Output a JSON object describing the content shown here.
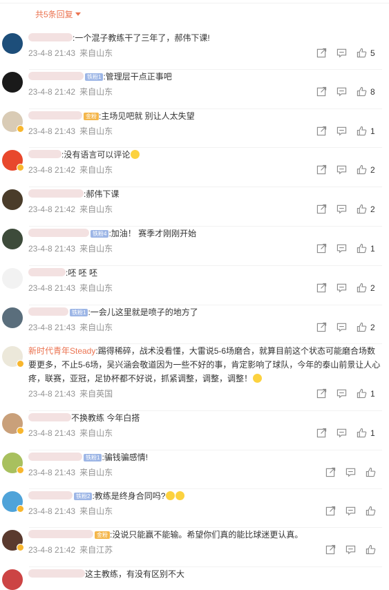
{
  "header": {
    "reply_toggle": "共5条回复"
  },
  "comments": [
    {
      "text": ":一个混子教练干了三年了，郝伟下课!",
      "date": "23-4-8 21:43",
      "location": "来自山东",
      "likes": "5",
      "avatar_color": "#1d4e7a"
    },
    {
      "text": ":管理层干点正事吧",
      "date": "23-4-8 21:42",
      "location": "来自山东",
      "likes": "8",
      "avatar_color": "#1a1a1a",
      "rank": "铁粉1"
    },
    {
      "text": ":主场见吧就  别让人太失望",
      "date": "23-4-8 21:43",
      "location": "来自山东",
      "likes": "1",
      "avatar_color": "#d9cbb5",
      "rank": "金粉"
    },
    {
      "text": ":没有语言可以评论",
      "date": "23-4-8 21:42",
      "location": "来自山东",
      "likes": "2",
      "avatar_color": "#e8482c"
    },
    {
      "text": ":郝伟下课",
      "date": "23-4-8 21:42",
      "location": "来自山东",
      "likes": "2",
      "avatar_color": "#4a3c2a"
    },
    {
      "text": ":加油！ 赛季才刚刚开始",
      "date": "23-4-8 21:43",
      "location": "来自山东",
      "likes": "1",
      "avatar_color": "#3d4b3a",
      "rank": "铁粉4"
    },
    {
      "text": ":呸 呸 呸",
      "date": "23-4-8 21:43",
      "location": "来自山东",
      "likes": "2",
      "avatar_color": "#f2f2f2"
    },
    {
      "text": ":一会儿这里就是喷子的地方了",
      "date": "23-4-8 21:43",
      "location": "来自山东",
      "likes": "2",
      "avatar_color": "#5a6e7c",
      "rank": "铁粉1"
    },
    {
      "name": "新时代青年Steady",
      "text": ":踢得稀碎，战术没看懂，大雷说5-6场磨合，就算目前这个状态可能磨合场数要更多，不止5-6场，吴兴涵会敬道因为一些不好的事，肯定影响了球队，今年的泰山前景让人心疼，联赛，亚冠，足协杯都不好说，抓紧调整，调整，调整！",
      "date": "23-4-8 21:43",
      "location": "来自英国",
      "likes": "1",
      "avatar_color": "#ece8da"
    },
    {
      "text": "不换教练 今年白搭",
      "date": "23-4-8 21:43",
      "location": "来自山东",
      "likes": "1",
      "avatar_color": "#c9a07a"
    },
    {
      "text": ":骗钱骗感情!",
      "date": "23-4-8 21:43",
      "location": "来自山东",
      "likes": "",
      "avatar_color": "#a8c05e",
      "rank": "铁粉1"
    },
    {
      "text": ":教练是终身合同吗?",
      "date": "23-4-8 21:43",
      "location": "来自山东",
      "likes": "",
      "avatar_color": "#4fa3d9",
      "rank": "铁粉2"
    },
    {
      "text": ":没说只能赢不能输。希望你们真的能比球迷更认真。",
      "date": "23-4-8 21:42",
      "location": "来自江苏",
      "likes": "",
      "avatar_color": "#5a3a2e",
      "rank": "金粉"
    },
    {
      "text": "这主教练，有没有区别不大",
      "date": "",
      "location": "",
      "likes": "",
      "avatar_color": "#c44"
    }
  ],
  "colors": {
    "accent": "#eb7350",
    "meta": "#939393",
    "icon": "#8a8a8a"
  },
  "icons": {
    "share": "share-icon",
    "comment": "comment-icon",
    "like": "thumbs-up-icon"
  }
}
